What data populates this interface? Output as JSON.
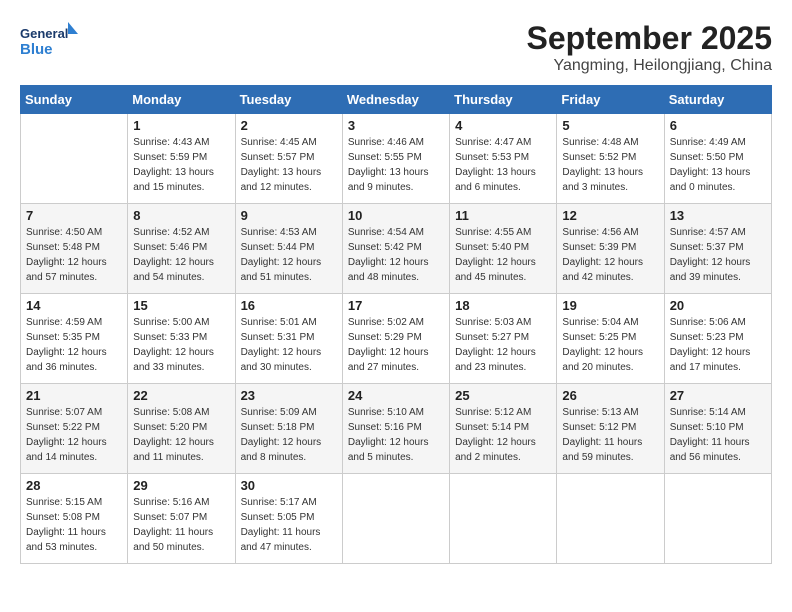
{
  "header": {
    "logo_line1": "General",
    "logo_line2": "Blue",
    "month_title": "September 2025",
    "subtitle": "Yangming, Heilongjiang, China"
  },
  "weekdays": [
    "Sunday",
    "Monday",
    "Tuesday",
    "Wednesday",
    "Thursday",
    "Friday",
    "Saturday"
  ],
  "weeks": [
    [
      {
        "day": "",
        "info": ""
      },
      {
        "day": "1",
        "info": "Sunrise: 4:43 AM\nSunset: 5:59 PM\nDaylight: 13 hours\nand 15 minutes."
      },
      {
        "day": "2",
        "info": "Sunrise: 4:45 AM\nSunset: 5:57 PM\nDaylight: 13 hours\nand 12 minutes."
      },
      {
        "day": "3",
        "info": "Sunrise: 4:46 AM\nSunset: 5:55 PM\nDaylight: 13 hours\nand 9 minutes."
      },
      {
        "day": "4",
        "info": "Sunrise: 4:47 AM\nSunset: 5:53 PM\nDaylight: 13 hours\nand 6 minutes."
      },
      {
        "day": "5",
        "info": "Sunrise: 4:48 AM\nSunset: 5:52 PM\nDaylight: 13 hours\nand 3 minutes."
      },
      {
        "day": "6",
        "info": "Sunrise: 4:49 AM\nSunset: 5:50 PM\nDaylight: 13 hours\nand 0 minutes."
      }
    ],
    [
      {
        "day": "7",
        "info": "Sunrise: 4:50 AM\nSunset: 5:48 PM\nDaylight: 12 hours\nand 57 minutes."
      },
      {
        "day": "8",
        "info": "Sunrise: 4:52 AM\nSunset: 5:46 PM\nDaylight: 12 hours\nand 54 minutes."
      },
      {
        "day": "9",
        "info": "Sunrise: 4:53 AM\nSunset: 5:44 PM\nDaylight: 12 hours\nand 51 minutes."
      },
      {
        "day": "10",
        "info": "Sunrise: 4:54 AM\nSunset: 5:42 PM\nDaylight: 12 hours\nand 48 minutes."
      },
      {
        "day": "11",
        "info": "Sunrise: 4:55 AM\nSunset: 5:40 PM\nDaylight: 12 hours\nand 45 minutes."
      },
      {
        "day": "12",
        "info": "Sunrise: 4:56 AM\nSunset: 5:39 PM\nDaylight: 12 hours\nand 42 minutes."
      },
      {
        "day": "13",
        "info": "Sunrise: 4:57 AM\nSunset: 5:37 PM\nDaylight: 12 hours\nand 39 minutes."
      }
    ],
    [
      {
        "day": "14",
        "info": "Sunrise: 4:59 AM\nSunset: 5:35 PM\nDaylight: 12 hours\nand 36 minutes."
      },
      {
        "day": "15",
        "info": "Sunrise: 5:00 AM\nSunset: 5:33 PM\nDaylight: 12 hours\nand 33 minutes."
      },
      {
        "day": "16",
        "info": "Sunrise: 5:01 AM\nSunset: 5:31 PM\nDaylight: 12 hours\nand 30 minutes."
      },
      {
        "day": "17",
        "info": "Sunrise: 5:02 AM\nSunset: 5:29 PM\nDaylight: 12 hours\nand 27 minutes."
      },
      {
        "day": "18",
        "info": "Sunrise: 5:03 AM\nSunset: 5:27 PM\nDaylight: 12 hours\nand 23 minutes."
      },
      {
        "day": "19",
        "info": "Sunrise: 5:04 AM\nSunset: 5:25 PM\nDaylight: 12 hours\nand 20 minutes."
      },
      {
        "day": "20",
        "info": "Sunrise: 5:06 AM\nSunset: 5:23 PM\nDaylight: 12 hours\nand 17 minutes."
      }
    ],
    [
      {
        "day": "21",
        "info": "Sunrise: 5:07 AM\nSunset: 5:22 PM\nDaylight: 12 hours\nand 14 minutes."
      },
      {
        "day": "22",
        "info": "Sunrise: 5:08 AM\nSunset: 5:20 PM\nDaylight: 12 hours\nand 11 minutes."
      },
      {
        "day": "23",
        "info": "Sunrise: 5:09 AM\nSunset: 5:18 PM\nDaylight: 12 hours\nand 8 minutes."
      },
      {
        "day": "24",
        "info": "Sunrise: 5:10 AM\nSunset: 5:16 PM\nDaylight: 12 hours\nand 5 minutes."
      },
      {
        "day": "25",
        "info": "Sunrise: 5:12 AM\nSunset: 5:14 PM\nDaylight: 12 hours\nand 2 minutes."
      },
      {
        "day": "26",
        "info": "Sunrise: 5:13 AM\nSunset: 5:12 PM\nDaylight: 11 hours\nand 59 minutes."
      },
      {
        "day": "27",
        "info": "Sunrise: 5:14 AM\nSunset: 5:10 PM\nDaylight: 11 hours\nand 56 minutes."
      }
    ],
    [
      {
        "day": "28",
        "info": "Sunrise: 5:15 AM\nSunset: 5:08 PM\nDaylight: 11 hours\nand 53 minutes."
      },
      {
        "day": "29",
        "info": "Sunrise: 5:16 AM\nSunset: 5:07 PM\nDaylight: 11 hours\nand 50 minutes."
      },
      {
        "day": "30",
        "info": "Sunrise: 5:17 AM\nSunset: 5:05 PM\nDaylight: 11 hours\nand 47 minutes."
      },
      {
        "day": "",
        "info": ""
      },
      {
        "day": "",
        "info": ""
      },
      {
        "day": "",
        "info": ""
      },
      {
        "day": "",
        "info": ""
      }
    ]
  ]
}
